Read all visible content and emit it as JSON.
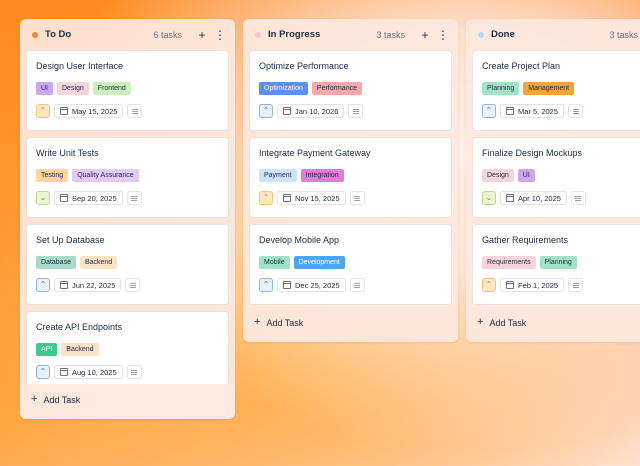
{
  "columns": [
    {
      "title": "To Do",
      "count": "6 tasks",
      "dot_color": "#f08a2c",
      "add_label": "Add Task",
      "cards": [
        {
          "title": "Design User Interface",
          "tags": [
            {
              "label": "UI",
              "bg": "#c9a7f2"
            },
            {
              "label": "Design",
              "bg": "#f7d4dc"
            },
            {
              "label": "Frontend",
              "bg": "#cfeec0"
            }
          ],
          "priority": "high",
          "date": "May 15, 2025"
        },
        {
          "title": "Write Unit Tests",
          "tags": [
            {
              "label": "Testing",
              "bg": "#fbd59a"
            },
            {
              "label": "Quality Assurance",
              "bg": "#e4c9f5"
            }
          ],
          "priority": "low",
          "date": "Sep 20, 2025"
        },
        {
          "title": "Set Up Database",
          "tags": [
            {
              "label": "Database",
              "bg": "#a7dcc8"
            },
            {
              "label": "Backend",
              "bg": "#fde3c6"
            }
          ],
          "priority": "medium",
          "date": "Jun 22, 2025"
        },
        {
          "title": "Create API Endpoints",
          "tags": [
            {
              "label": "API",
              "bg": "#3ec98a"
            },
            {
              "label": "Backend",
              "bg": "#fde3c6"
            }
          ],
          "priority": "medium",
          "date": "Aug 10, 2025"
        }
      ]
    },
    {
      "title": "In Progress",
      "count": "3 tasks",
      "dot_color": "#f5c6d6",
      "add_label": "Add Task",
      "cards": [
        {
          "title": "Optimize Performance",
          "tags": [
            {
              "label": "Optimization",
              "bg": "#5b8ff0"
            },
            {
              "label": "Performance",
              "bg": "#f3a9a9"
            }
          ],
          "priority": "medium",
          "date": "Jan 10, 2026"
        },
        {
          "title": "Integrate Payment Gateway",
          "tags": [
            {
              "label": "Payment",
              "bg": "#cfe2fb"
            },
            {
              "label": "Integration",
              "bg": "#e879d8"
            }
          ],
          "priority": "high",
          "date": "Nov 15, 2025"
        },
        {
          "title": "Develop Mobile App",
          "tags": [
            {
              "label": "Mobile",
              "bg": "#9ee3c5"
            },
            {
              "label": "Development",
              "bg": "#4ea5ef"
            }
          ],
          "priority": "medium",
          "date": "Dec 25, 2025"
        }
      ]
    },
    {
      "title": "Done",
      "count": "3 tasks",
      "dot_color": "#bcd8f5",
      "add_label": "Add Task",
      "cards": [
        {
          "title": "Create Project Plan",
          "tags": [
            {
              "label": "Planning",
              "bg": "#a2e3c8"
            },
            {
              "label": "Management",
              "bg": "#f7a23a"
            }
          ],
          "priority": "medium",
          "date": "Mar 5, 2025"
        },
        {
          "title": "Finalize Design Mockups",
          "tags": [
            {
              "label": "Design",
              "bg": "#f7d4dc"
            },
            {
              "label": "UI",
              "bg": "#c9a7f2"
            }
          ],
          "priority": "low",
          "date": "Apr 10, 2025"
        },
        {
          "title": "Gather Requirements",
          "tags": [
            {
              "label": "Requirements",
              "bg": "#f7d4dc"
            },
            {
              "label": "Planning",
              "bg": "#a2e3c8"
            }
          ],
          "priority": "high",
          "date": "Feb 1, 2025"
        }
      ]
    }
  ],
  "icons": {
    "add": "plus-icon",
    "menu": "more-vertical-icon",
    "calendar": "calendar-icon",
    "notes": "notes-icon"
  }
}
